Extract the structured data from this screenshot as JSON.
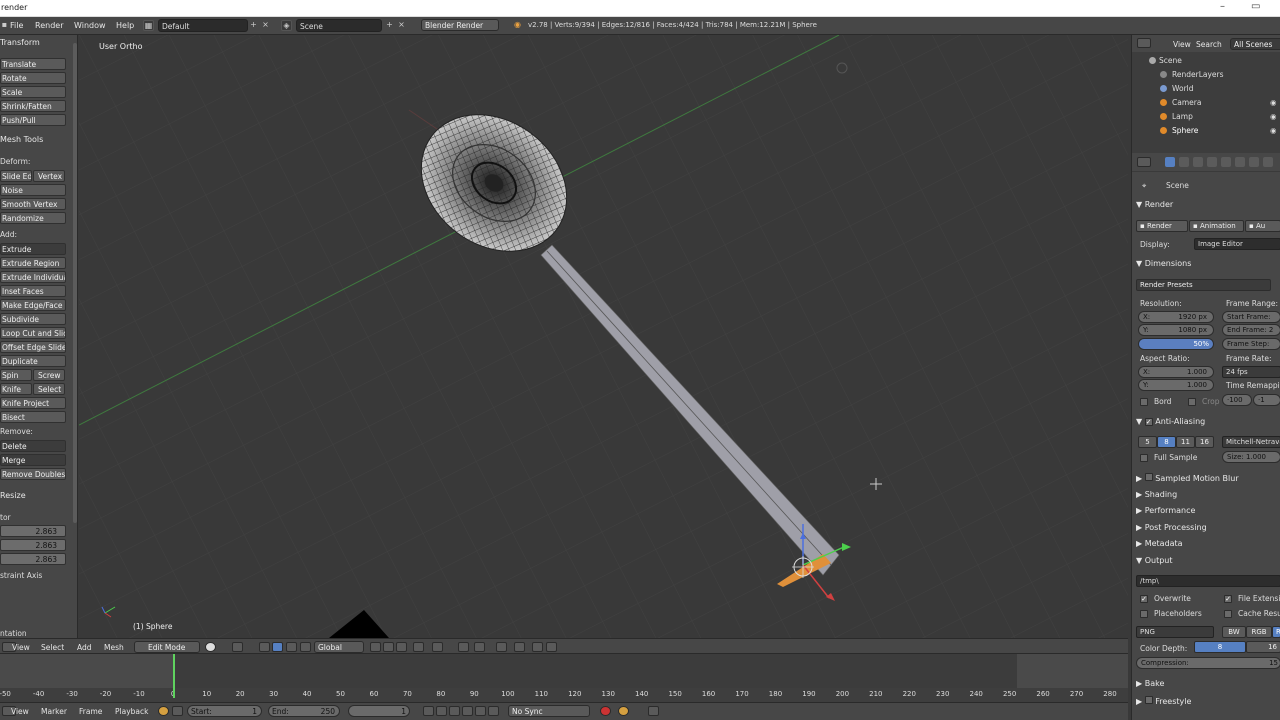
{
  "window": {
    "title": "render",
    "min": "–",
    "max": "▭"
  },
  "info": {
    "menus": [
      "File",
      "Render",
      "Window",
      "Help"
    ],
    "layout": "Default",
    "scene": "Scene",
    "engine": "Blender Render",
    "stats": "v2.78 | Verts:9/394 | Edges:12/816 | Faces:4/424 | Tris:784 | Mem:12.21M | Sphere"
  },
  "tools": {
    "transform_header": "Transform",
    "transform": [
      "Translate",
      "Rotate",
      "Scale",
      "Shrink/Fatten",
      "Push/Pull"
    ],
    "meshtools_header": "Mesh Tools",
    "deform_label": "Deform:",
    "slide_edge": "Slide Ed",
    "vertex": "Vertex",
    "deform": [
      "Noise",
      "Smooth Vertex",
      "Randomize"
    ],
    "add_label": "Add:",
    "extrude": "Extrude",
    "add": [
      "Extrude Region",
      "Extrude Individual",
      "Inset Faces",
      "Make Edge/Face",
      "Subdivide",
      "Loop Cut and Slide",
      "Offset Edge Slide",
      "Duplicate"
    ],
    "spin": "Spin",
    "screw": "Screw",
    "knife": "Knife",
    "select": "Select",
    "knife_project": "Knife Project",
    "bisect": "Bisect",
    "remove_label": "Remove:",
    "delete": "Delete",
    "merge": "Merge",
    "remove_doubles": "Remove Doubles",
    "resize_header": "Resize",
    "vector_label": "tor",
    "vector": [
      "2.863",
      "2.863",
      "2.863"
    ],
    "constraint": "straint Axis",
    "orientation": "ntation"
  },
  "viewport": {
    "title": "User Ortho",
    "object": "(1) Sphere"
  },
  "header3d": {
    "menus": [
      "View",
      "Select",
      "Add",
      "Mesh"
    ],
    "mode": "Edit Mode",
    "orientation": "Global"
  },
  "timeline": {
    "ticks": [
      "-50",
      "-40",
      "-30",
      "-20",
      "-10",
      "0",
      "10",
      "20",
      "30",
      "40",
      "50",
      "60",
      "70",
      "80",
      "90",
      "100",
      "110",
      "120",
      "130",
      "140",
      "150",
      "160",
      "170",
      "180",
      "190",
      "200",
      "210",
      "220",
      "230",
      "240",
      "250",
      "260",
      "270",
      "280"
    ],
    "menus": [
      "View",
      "Marker",
      "Frame",
      "Playback"
    ],
    "start": "Start:",
    "start_val": "1",
    "end": "End:",
    "end_val": "250",
    "current": "1",
    "sync": "No Sync"
  },
  "outliner": {
    "view": "View",
    "search": "Search",
    "scope": "All Scenes",
    "items": [
      "Scene",
      "RenderLayers",
      "World",
      "Camera",
      "Lamp",
      "Sphere"
    ]
  },
  "props": {
    "scene": "Scene",
    "render_header": "Render",
    "render_btn": "Render",
    "animation_btn": "Animation",
    "audio_btn": "Au",
    "display_label": "Display:",
    "display_val": "Image Editor",
    "dimensions": "Dimensions",
    "presets": "Render Presets",
    "resolution": "Resolution:",
    "res_x": "X:",
    "res_x_val": "1920 px",
    "res_y": "Y:",
    "res_y_val": "1080 px",
    "res_pct": "50%",
    "frame_range": "Frame Range:",
    "start_frame": "Start Frame:",
    "end_frame": "End Frame: 2",
    "frame_step": "Frame Step:",
    "aspect": "Aspect Ratio:",
    "asp_x_val": "1.000",
    "asp_y_val": "1.000",
    "frame_rate": "Frame Rate:",
    "fps": "24 fps",
    "time_remap": "Time Remapping",
    "border": "Bord",
    "crop": "Crop",
    "remap_old": "·100",
    "remap_new": "·1",
    "aa": "Anti-Aliasing",
    "aa_levels": [
      "5",
      "8",
      "11",
      "16"
    ],
    "filter": "Mitchell-Netrava",
    "full_sample": "Full Sample",
    "size": "Size:",
    "size_val": "1.000",
    "sections": [
      "Sampled Motion Blur",
      "Shading",
      "Performance",
      "Post Processing",
      "Metadata"
    ],
    "output": "Output",
    "path": "/tmp\\",
    "overwrite": "Overwrite",
    "file_ext": "File Extensio",
    "placeholders": "Placeholders",
    "cache": "Cache Resul",
    "format": "PNG",
    "bw": "BW",
    "rgb": "RGB",
    "rgba": "R",
    "color_depth": "Color Depth:",
    "depth8": "8",
    "depth16": "16",
    "compression": "Compression:",
    "comp_val": "15",
    "bake": "Bake",
    "freestyle": "Freestyle"
  }
}
